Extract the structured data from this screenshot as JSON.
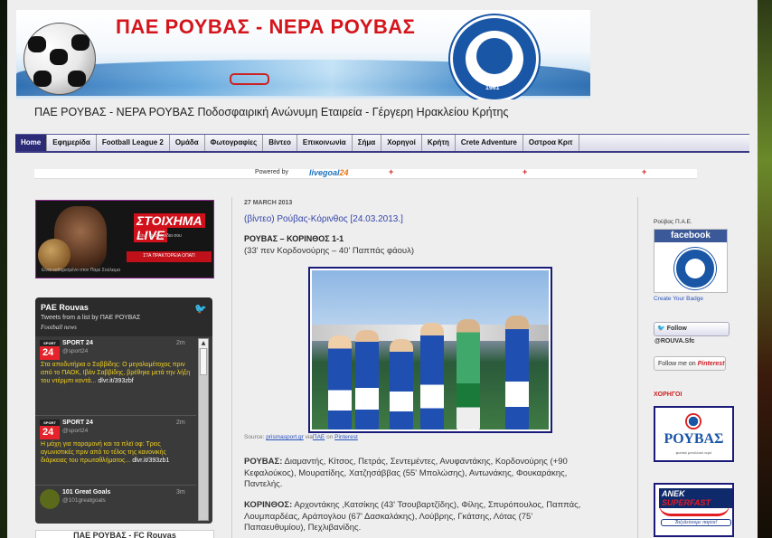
{
  "banner": {
    "title": "ΠΑΕ ΡΟΥΒΑΣ - ΝΕΡΑ ΡΟΥΒΑΣ",
    "year": "1961"
  },
  "tagline": "ΠΑΕ ΡΟΥΒΑΣ - ΝΕΡΑ ΡΟΥΒΑΣ Ποδοσφαιρική Ανώνυμη Εταιρεία - Γέργερη Ηρακλείου Κρήτης",
  "nav": [
    "Home",
    "Εφημερίδα",
    "Football League 2",
    "Ομάδα",
    "Φωτογραφίες",
    "Βίντεο",
    "Επικοινωνία",
    "Σήμα",
    "Χορηγοί",
    "Κρήτη",
    "Crete Adventure",
    "Οστροα Κριτ"
  ],
  "ticker": {
    "powered": "Powered by",
    "brand_a": "livegoal",
    "brand_b": "24",
    "mark": "+"
  },
  "left": {
    "ad": {
      "brand": "ΣΤΟΙΧΗΜΑ",
      "brand2": "LIVE",
      "sub": "Κάνε τα παιχνίδια σου",
      "strip": "ΣΤΑ ΠΡΑΚΤΟΡΕΙΑ ΟΠΑΠ",
      "caption": "Είναι καθαρισμένο στον Παρέ Σούλειμα"
    },
    "twitter": {
      "title": "PAE Rouvas",
      "subtitle": "Tweets from a list by ΠΑΕ ΡΟΥΒΑΣ",
      "list": "Football news",
      "tweets": [
        {
          "name": "SPORT 24",
          "handle": "@sport24",
          "time": "2m",
          "avatar_top": "SPORT",
          "avatar_num": "24",
          "text": "Στα αποδυτήρια ο Σαββίδης: Ο μεγαλομέτοχος πριν από το ΠΑΟΚ, Ιβάν Σαββίδης, βρέθηκε μετά την λήξη του ντέρμπι κοντά...",
          "link": "dlvr.it/393zbf"
        },
        {
          "name": "SPORT 24",
          "handle": "@sport24",
          "time": "2m",
          "avatar_top": "SPORT",
          "avatar_num": "24",
          "text": "Η μάχη για παραμονή και τα πλεϊ οφ: Τρεις αγωνιστικές πριν από το τέλος της κανονικής διάρκειας του πρωταθλήματος...",
          "link": "dlvr.it/393zb1"
        },
        {
          "name": "101 Great Goals",
          "handle": "@101greatgoals",
          "time": "3m"
        }
      ]
    },
    "bottom_box": "ΠΑΕ ΡΟΥΒΑΣ - FC Rouvas"
  },
  "post": {
    "date": "27 MARCH 2013",
    "title": "(βίντεο) Ρούβας-Κόρινθος [24.03.2013.]",
    "score": "ΡΟΥΒΑΣ – ΚΟΡΙΝΘΟΣ 1-1",
    "goals": "(33' πεν Κορδονούρης – 40' Παππάς φάουλ)",
    "credit_source": "Source:",
    "credit_site": "prismasport.gr",
    "credit_via": " via",
    "credit_user": "ΠΑΕ",
    "credit_on": " on ",
    "credit_pin": "Pinterest",
    "lineup1_team": "ΡΟΥΒΑΣ:",
    "lineup1": " Διαμαντής, Κίτσος, Πετράς, Σεντεμέντες, Ανυφαντάκης, Κορδονούρης (+90 Κεφαλούκος), Μουρατίδης, Χατζησάββας (55' Μπολώσης), Αντωνάκης, Φουκαράκης, Παντελής.",
    "lineup2_team": "ΚΟΡΙΝΘΟΣ:",
    "lineup2": " Αρχοντάκης ,Κατσίκης (43' Τσουβαρτζίδης), Φίλης, Σπυρόπουλος, Παππάς, Λουμπαρδέας, Αράπογλου (67' Δασκαλάκης), Λούβρης, Γκάτσης, Λότας (75' Παπαευθυμίου), Πεχλιβανίδης."
  },
  "right": {
    "label1": "Ρούβας Π.Α.Ε.",
    "fb": "facebook",
    "badge_link": "Create Your Badge",
    "follow": "Follow @ROUVA.Sfc",
    "pin_a": "Follow me on ",
    "pin_b": "Pinterest",
    "sponsors": "ΧΟΡΗΓΟΙ",
    "sp1_title": "ΡΟΥΒΑΣ",
    "sp1_sub": "φυσικό μεταλλικό νερό",
    "sp2_a": "ANEK",
    "sp2_b": " SUPERFAST",
    "sp2_sub": "Ταξιδεύουμε παρέα!"
  }
}
